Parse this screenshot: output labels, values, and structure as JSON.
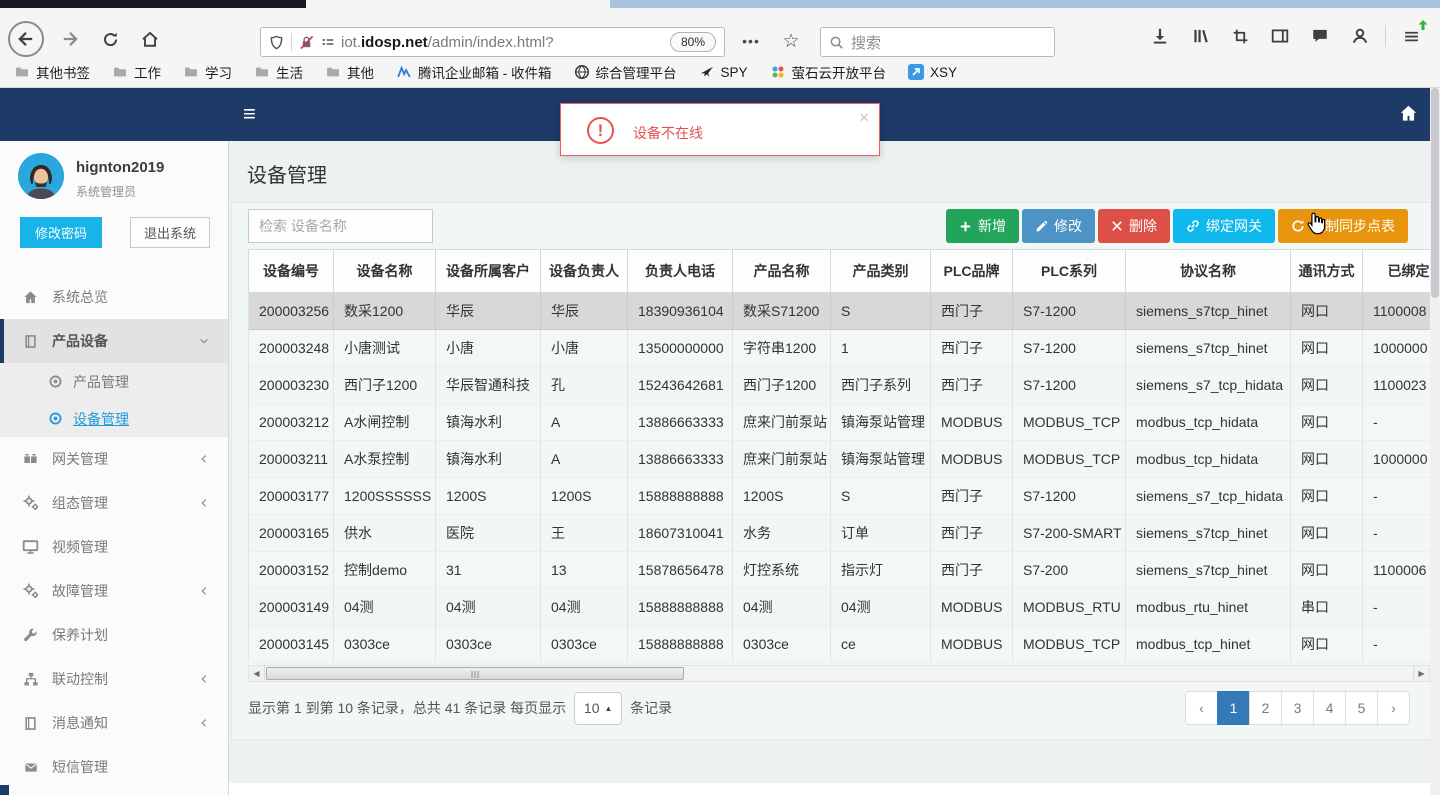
{
  "browser": {
    "url_prefix": "iot.",
    "url_domain": "idosp.net",
    "url_path": "/admin/index.html?",
    "zoom_level": "80%",
    "search_placeholder": "搜索",
    "bookmarks": [
      {
        "label": "其他书签",
        "icon": "folder-icon"
      },
      {
        "label": "工作",
        "icon": "folder-icon"
      },
      {
        "label": "学习",
        "icon": "folder-icon"
      },
      {
        "label": "生活",
        "icon": "folder-icon"
      },
      {
        "label": "其他",
        "icon": "folder-icon"
      },
      {
        "label": "腾讯企业邮箱 - 收件箱",
        "icon": "tencent-mail-icon"
      },
      {
        "label": "综合管理平台",
        "icon": "globe-icon"
      },
      {
        "label": "SPY",
        "icon": "spy-icon"
      },
      {
        "label": "萤石云开放平台",
        "icon": "ezviz-icon"
      },
      {
        "label": "XSY",
        "icon": "xsy-icon"
      }
    ]
  },
  "alert": {
    "message": "设备不在线",
    "close_label": "×"
  },
  "navbar": {
    "menu_toggle": "≡"
  },
  "sidebar": {
    "username": "hignton2019",
    "role": "系统管理员",
    "buttons": {
      "change_password": "修改密码",
      "logout": "退出系统"
    },
    "menu": [
      {
        "label": "系统总览",
        "icon": "home-icon"
      },
      {
        "label": "产品设备",
        "icon": "book-icon",
        "chevron": "down",
        "active": true,
        "children": [
          {
            "label": "产品管理",
            "icon": "target-icon"
          },
          {
            "label": "设备管理",
            "icon": "target-icon",
            "active": true
          }
        ]
      },
      {
        "label": "网关管理",
        "icon": "camera-icon",
        "chevron": "left"
      },
      {
        "label": "组态管理",
        "icon": "gears-icon",
        "chevron": "left"
      },
      {
        "label": "视频管理",
        "icon": "monitor-icon"
      },
      {
        "label": "故障管理",
        "icon": "gears-icon",
        "chevron": "left"
      },
      {
        "label": "保养计划",
        "icon": "wrench-icon"
      },
      {
        "label": "联动控制",
        "icon": "sitemap-icon",
        "chevron": "left"
      },
      {
        "label": "消息通知",
        "icon": "book-icon",
        "chevron": "left"
      },
      {
        "label": "短信管理",
        "icon": "envelope-icon"
      }
    ]
  },
  "main": {
    "title": "设备管理",
    "search_placeholder": "检索 设备名称",
    "toolbar": [
      {
        "label": "新增",
        "icon": "plus-icon",
        "color": "#23a45b"
      },
      {
        "label": "修改",
        "icon": "pencil-icon",
        "color": "#4e93c6"
      },
      {
        "label": "删除",
        "icon": "x-icon",
        "color": "#dd5047"
      },
      {
        "label": "绑定网关",
        "icon": "link-icon",
        "color": "#0fb9ed"
      },
      {
        "label": "强制同步点表",
        "icon": "refresh-icon",
        "color": "#e8940d"
      }
    ],
    "table": {
      "headers": [
        "设备编号",
        "设备名称",
        "设备所属客户",
        "设备负责人",
        "负责人电话",
        "产品名称",
        "产品类别",
        "PLC品牌",
        "PLC系列",
        "协议名称",
        "通讯方式",
        "已绑定网关"
      ],
      "selected_row_index": 0,
      "rows": [
        [
          "200003256",
          "数采1200",
          "华辰",
          "华辰",
          "18390936104",
          "数采S71200",
          "S",
          "西门子",
          "S7-1200",
          "siemens_s7tcp_hinet",
          "网口",
          "1100008"
        ],
        [
          "200003248",
          "小唐测试",
          "小唐",
          "小唐",
          "13500000000",
          "字符串1200",
          "1",
          "西门子",
          "S7-1200",
          "siemens_s7tcp_hinet",
          "网口",
          "1000000"
        ],
        [
          "200003230",
          "西门子1200",
          "华辰智通科技",
          "孔",
          "15243642681",
          "西门子1200",
          "西门子系列",
          "西门子",
          "S7-1200",
          "siemens_s7_tcp_hidata",
          "网口",
          "1100023"
        ],
        [
          "200003212",
          "A水闸控制",
          "镇海水利",
          "A",
          "13886663333",
          "庶来门前泵站",
          "镇海泵站管理",
          "MODBUS",
          "MODBUS_TCP",
          "modbus_tcp_hidata",
          "网口",
          "-"
        ],
        [
          "200003211",
          "A水泵控制",
          "镇海水利",
          "A",
          "13886663333",
          "庶来门前泵站",
          "镇海泵站管理",
          "MODBUS",
          "MODBUS_TCP",
          "modbus_tcp_hidata",
          "网口",
          "1000000"
        ],
        [
          "200003177",
          "1200SSSSSS",
          "1200S",
          "1200S",
          "15888888888",
          "1200S",
          "S",
          "西门子",
          "S7-1200",
          "siemens_s7_tcp_hidata",
          "网口",
          "-"
        ],
        [
          "200003165",
          "供水",
          "医院",
          "王",
          "18607310041",
          "水务",
          "订单",
          "西门子",
          "S7-200-SMART",
          "siemens_s7tcp_hinet",
          "网口",
          "-"
        ],
        [
          "200003152",
          "控制demo",
          "31",
          "13",
          "15878656478",
          "灯控系统",
          "指示灯",
          "西门子",
          "S7-200",
          "siemens_s7tcp_hinet",
          "网口",
          "1100006"
        ],
        [
          "200003149",
          "04测",
          "04测",
          "04测",
          "15888888888",
          "04测",
          "04测",
          "MODBUS",
          "MODBUS_RTU",
          "modbus_rtu_hinet",
          "串口",
          "-"
        ],
        [
          "200003145",
          "0303ce",
          "0303ce",
          "0303ce",
          "15888888888",
          "0303ce",
          "ce",
          "MODBUS",
          "MODBUS_TCP",
          "modbus_tcp_hinet",
          "网口",
          "-"
        ]
      ]
    },
    "footer": {
      "summary": "显示第 1 到第 10 条记录，总共 41 条记录 每页显示",
      "page_size": "10",
      "suffix": "条记录",
      "pagination": {
        "prev": "‹",
        "pages": [
          "1",
          "2",
          "3",
          "4",
          "5"
        ],
        "active_page": "1",
        "next": "›"
      }
    }
  },
  "colors": {
    "navbar": "#1e3a66",
    "accent_blue": "#1d9ce0",
    "selected_row": "#d8d8d8",
    "page_active": "#337ab7",
    "alert_red": "#e25555",
    "change_password_cyan": "#18b4e9"
  }
}
